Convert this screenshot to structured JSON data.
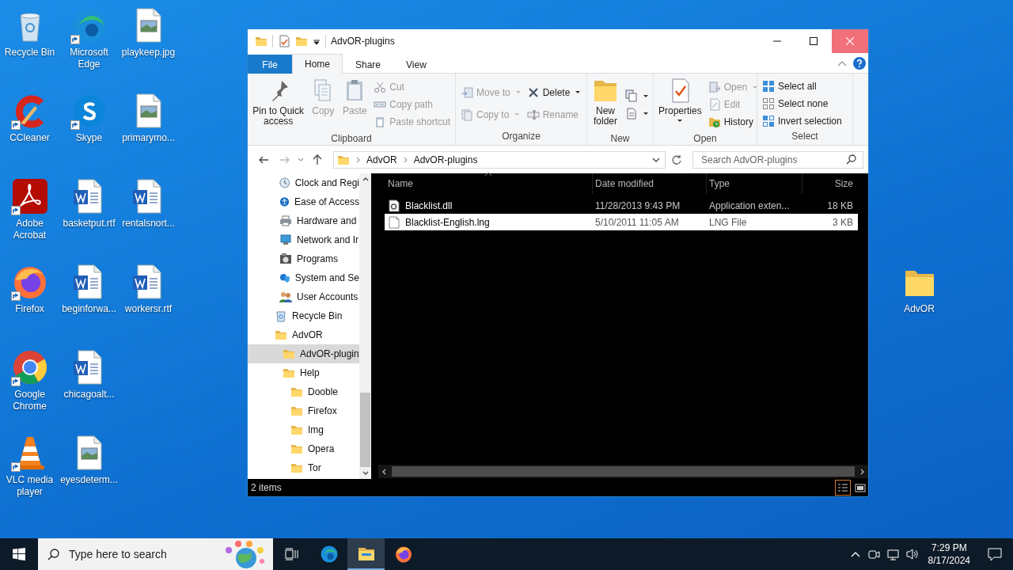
{
  "desktop": {
    "icons": [
      {
        "label": "Recycle Bin",
        "kind": "recycle",
        "shortcut": false
      },
      {
        "label": "CCleaner",
        "kind": "ccleaner",
        "shortcut": true
      },
      {
        "label": "Adobe Acrobat",
        "kind": "acrobat",
        "shortcut": true
      },
      {
        "label": "Firefox",
        "kind": "firefox",
        "shortcut": true
      },
      {
        "label": "Google Chrome",
        "kind": "chrome",
        "shortcut": true
      },
      {
        "label": "VLC media player",
        "kind": "vlc",
        "shortcut": true
      },
      {
        "label": "Microsoft Edge",
        "kind": "edge",
        "shortcut": true
      },
      {
        "label": "Skype",
        "kind": "skype",
        "shortcut": true
      },
      {
        "label": "basketput.rtf",
        "kind": "word",
        "shortcut": false
      },
      {
        "label": "beginforwa...",
        "kind": "word",
        "shortcut": false
      },
      {
        "label": "chicagoalt...",
        "kind": "word",
        "shortcut": false
      },
      {
        "label": "eyesdeterm...",
        "kind": "image",
        "shortcut": false
      },
      {
        "label": "playkeep.jpg",
        "kind": "image",
        "shortcut": false
      },
      {
        "label": "primarymo...",
        "kind": "image",
        "shortcut": false
      },
      {
        "label": "rentalsnort...",
        "kind": "word",
        "shortcut": false
      },
      {
        "label": "workersr.rtf",
        "kind": "word",
        "shortcut": false
      }
    ],
    "side_icon": {
      "label": "AdvOR",
      "kind": "folder",
      "shortcut": false
    }
  },
  "explorer": {
    "title": "AdvOR-plugins",
    "tabs": [
      {
        "label": "File",
        "kind": "file",
        "selected": false
      },
      {
        "label": "Home",
        "kind": "tab",
        "selected": true
      },
      {
        "label": "Share",
        "kind": "tab",
        "selected": false
      },
      {
        "label": "View",
        "kind": "tab",
        "selected": false
      }
    ],
    "ribbon": [
      {
        "label": "Clipboard",
        "columns": [
          [
            {
              "label": "Pin to Quick access",
              "kind": "pin",
              "disabled": false,
              "dropdown": false
            }
          ],
          [
            {
              "label": "Copy",
              "kind": "copy",
              "disabled": true,
              "dropdown": false
            }
          ],
          [
            {
              "label": "Paste",
              "kind": "paste",
              "disabled": true,
              "dropdown": false
            }
          ],
          [
            {
              "label": "Cut",
              "kind": "cut",
              "disabled": true,
              "dropdown": false
            },
            {
              "label": "Copy path",
              "kind": "copypath",
              "disabled": true,
              "dropdown": false
            },
            {
              "label": "Paste shortcut",
              "kind": "pasteshortcut",
              "disabled": true,
              "dropdown": false
            }
          ]
        ]
      },
      {
        "label": "Organize",
        "columns": [
          [
            {
              "label": "Move to",
              "kind": "move",
              "disabled": true,
              "dropdown": true
            },
            {
              "label": "Copy to",
              "kind": "copyto",
              "disabled": true,
              "dropdown": true
            }
          ],
          [
            {
              "label": "Delete",
              "kind": "delete",
              "disabled": false,
              "dropdown": true
            },
            {
              "label": "Rename",
              "kind": "rename",
              "disabled": true,
              "dropdown": false
            }
          ]
        ]
      },
      {
        "label": "New",
        "columns": [
          [
            {
              "label": "New folder",
              "kind": "newfolder",
              "disabled": false,
              "dropdown": false
            }
          ],
          [
            {
              "kind": "newitem",
              "disabled": false,
              "dropdown": true
            },
            {
              "kind": "easyaccess",
              "disabled": false,
              "dropdown": true
            }
          ]
        ]
      },
      {
        "label": "Open",
        "columns": [
          [
            {
              "label": "Properties",
              "kind": "properties",
              "disabled": false,
              "dropdown": true
            }
          ],
          [
            {
              "label": "Open",
              "kind": "open",
              "disabled": true,
              "dropdown": true
            },
            {
              "label": "Edit",
              "kind": "edit",
              "disabled": true,
              "dropdown": false
            },
            {
              "label": "History",
              "kind": "history",
              "disabled": false,
              "dropdown": false
            }
          ]
        ]
      },
      {
        "label": "Select",
        "columns": [
          [
            {
              "label": "Select all",
              "kind": "selectall",
              "disabled": false,
              "dropdown": false
            },
            {
              "label": "Select none",
              "kind": "selectnone",
              "disabled": false,
              "dropdown": false
            },
            {
              "label": "Invert selection",
              "kind": "invert",
              "disabled": false,
              "dropdown": false
            }
          ]
        ]
      }
    ],
    "address": {
      "crumbs": [
        "AdvOR",
        "AdvOR-plugins"
      ]
    },
    "search": {
      "placeholder": "Search AdvOR-plugins"
    },
    "nav_pane": {
      "continued_items": [
        {
          "label": "Clock and Regi",
          "kind": "clock",
          "selected": false
        },
        {
          "label": "Ease of Access",
          "kind": "ease",
          "selected": false
        },
        {
          "label": "Hardware and",
          "kind": "hardware",
          "selected": false
        },
        {
          "label": "Network and Ir",
          "kind": "network",
          "selected": false
        },
        {
          "label": "Programs",
          "kind": "programs",
          "selected": false
        },
        {
          "label": "System and Se",
          "kind": "system",
          "selected": false
        },
        {
          "label": "User Accounts",
          "kind": "users",
          "selected": false
        }
      ],
      "items": [
        {
          "label": "Recycle Bin",
          "kind": "recycle",
          "selected": false
        },
        {
          "label": "AdvOR",
          "kind": "folder",
          "selected": false,
          "children": [
            {
              "label": "AdvOR-plugin",
              "kind": "folder",
              "selected": true
            },
            {
              "label": "Help",
              "kind": "folder",
              "selected": false,
              "children": [
                {
                  "label": "Dooble",
                  "kind": "folder",
                  "selected": false
                },
                {
                  "label": "Firefox",
                  "kind": "folder",
                  "selected": false
                },
                {
                  "label": "Img",
                  "kind": "folder",
                  "selected": false
                },
                {
                  "label": "Opera",
                  "kind": "folder",
                  "selected": false
                },
                {
                  "label": "Tor",
                  "kind": "folder",
                  "selected": false
                }
              ]
            }
          ]
        }
      ]
    },
    "file_list": {
      "columns": [
        {
          "label": "Name",
          "sorted": true
        },
        {
          "label": "Date modified",
          "sorted": false
        },
        {
          "label": "Type",
          "sorted": false
        },
        {
          "label": "Size",
          "sorted": false
        }
      ],
      "rows": [
        {
          "name": "Blacklist.dll",
          "date": "11/28/2013 9:43 PM",
          "type": "Application exten...",
          "size": "18 KB",
          "kind": "dll",
          "selected": false
        },
        {
          "name": "Blacklist-English.lng",
          "date": "5/10/2011 11:05 AM",
          "type": "LNG File",
          "size": "3 KB",
          "kind": "file",
          "selected": true
        }
      ]
    },
    "status_bar": {
      "text": "2 items",
      "views": [
        {
          "kind": "details",
          "selected": true
        },
        {
          "kind": "large_icons",
          "selected": false
        }
      ]
    }
  },
  "taskbar": {
    "search": {
      "placeholder": "Type here to search"
    },
    "apps": [
      {
        "kind": "taskview",
        "active": false
      },
      {
        "kind": "edge",
        "active": false
      },
      {
        "kind": "explorer",
        "active": true
      },
      {
        "kind": "firefox",
        "active": false
      }
    ],
    "clock": {
      "time": "7:29 PM",
      "date": "8/17/2024"
    }
  }
}
